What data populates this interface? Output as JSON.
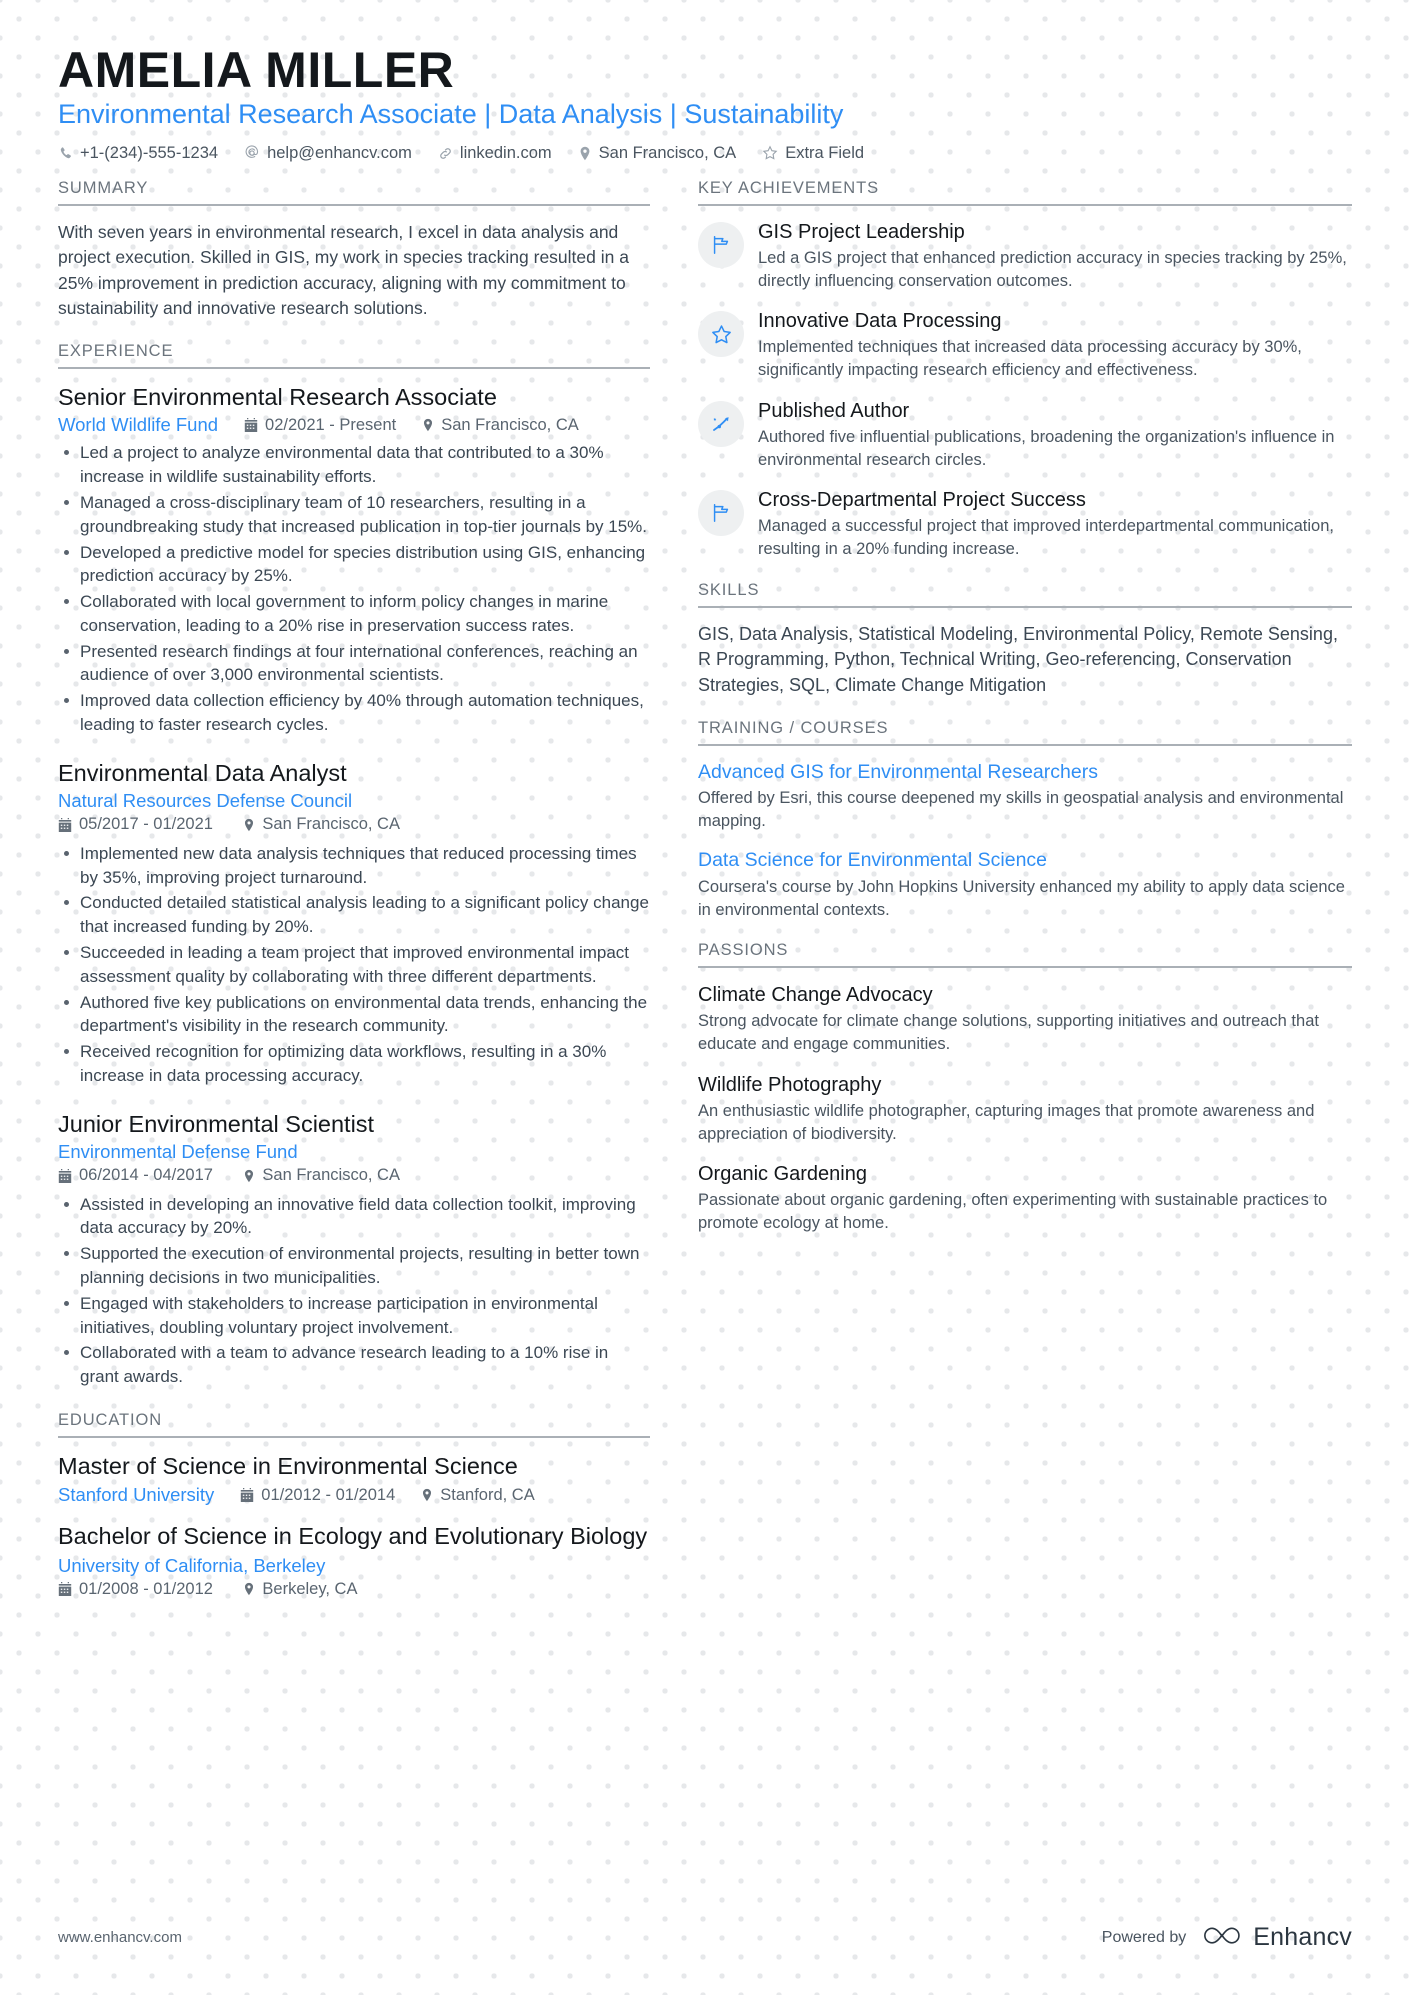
{
  "theme": {
    "accent": "#2f8ef4",
    "text": "#32404e",
    "muted": "#6b747d",
    "rule": "#aab0b6"
  },
  "header": {
    "name": "AMELIA MILLER",
    "headline": "Environmental Research Associate | Data Analysis | Sustainability",
    "contacts": [
      {
        "icon": "phone-icon",
        "text": "+1-(234)-555-1234"
      },
      {
        "icon": "email-icon",
        "text": "help@enhancv.com"
      },
      {
        "icon": "link-icon",
        "text": "linkedin.com"
      },
      {
        "icon": "location-icon",
        "text": "San Francisco, CA"
      },
      {
        "icon": "star-icon",
        "text": "Extra Field"
      }
    ]
  },
  "left": {
    "summary": {
      "title": "SUMMARY",
      "text": "With seven years in environmental research, I excel in data analysis and project execution. Skilled in GIS, my work in species tracking resulted in a 25% improvement in prediction accuracy, aligning with my commitment to sustainability and innovative research solutions."
    },
    "experience": {
      "title": "EXPERIENCE",
      "jobs": [
        {
          "title": "Senior Environmental Research Associate",
          "company": "World Wildlife Fund",
          "dates": "02/2021 - Present",
          "location": "San Francisco, CA",
          "inline_meta": true,
          "bullets": [
            "Led a project to analyze environmental data that contributed to a 30% increase in wildlife sustainability efforts.",
            "Managed a cross-disciplinary team of 10 researchers, resulting in a groundbreaking study that increased publication in top-tier journals by 15%.",
            "Developed a predictive model for species distribution using GIS, enhancing prediction accuracy by 25%.",
            "Collaborated with local government to inform policy changes in marine conservation, leading to a 20% rise in preservation success rates.",
            "Presented research findings at four international conferences, reaching an audience of over 3,000 environmental scientists.",
            "Improved data collection efficiency by 40% through automation techniques, leading to faster research cycles."
          ]
        },
        {
          "title": "Environmental Data Analyst",
          "company": "Natural Resources Defense Council",
          "dates": "05/2017 - 01/2021",
          "location": "San Francisco, CA",
          "inline_meta": false,
          "bullets": [
            "Implemented new data analysis techniques that reduced processing times by 35%, improving project turnaround.",
            "Conducted detailed statistical analysis leading to a significant policy change that increased funding by 20%.",
            "Succeeded in leading a team project that improved environmental impact assessment quality by collaborating with three different departments.",
            "Authored five key publications on environmental data trends, enhancing the department's visibility in the research community.",
            "Received recognition for optimizing data workflows, resulting in a 30% increase in data processing accuracy."
          ]
        },
        {
          "title": "Junior Environmental Scientist",
          "company": "Environmental Defense Fund",
          "dates": "06/2014 - 04/2017",
          "location": "San Francisco, CA",
          "inline_meta": false,
          "bullets": [
            "Assisted in developing an innovative field data collection toolkit, improving data accuracy by 20%.",
            "Supported the execution of environmental projects, resulting in better town planning decisions in two municipalities.",
            "Engaged with stakeholders to increase participation in environmental initiatives, doubling voluntary project involvement.",
            "Collaborated with a team to advance research leading to a 10% rise in grant awards."
          ]
        }
      ]
    },
    "education": {
      "title": "EDUCATION",
      "items": [
        {
          "degree": "Master of Science in Environmental Science",
          "school": "Stanford University",
          "dates": "01/2012 - 01/2014",
          "location": "Stanford, CA",
          "inline_meta": true
        },
        {
          "degree": "Bachelor of Science in Ecology and Evolutionary Biology",
          "school": "University of California, Berkeley",
          "dates": "01/2008 - 01/2012",
          "location": "Berkeley, CA",
          "inline_meta": false
        }
      ]
    }
  },
  "right": {
    "achievements": {
      "title": "KEY ACHIEVEMENTS",
      "items": [
        {
          "icon": "flag-icon",
          "title": "GIS Project Leadership",
          "text": "Led a GIS project that enhanced prediction accuracy in species tracking by 25%, directly influencing conservation outcomes."
        },
        {
          "icon": "star-icon",
          "title": "Innovative Data Processing",
          "text": "Implemented techniques that increased data processing accuracy by 30%, significantly impacting research efficiency and effectiveness."
        },
        {
          "icon": "trend-arrow-icon",
          "title": "Published Author",
          "text": "Authored five influential publications, broadening the organization's influence in environmental research circles."
        },
        {
          "icon": "flag-icon",
          "title": "Cross-Departmental Project Success",
          "text": "Managed a successful project that improved interdepartmental communication, resulting in a 20% funding increase."
        }
      ]
    },
    "skills": {
      "title": "SKILLS",
      "text": "GIS, Data Analysis, Statistical Modeling, Environmental Policy, Remote Sensing, R Programming, Python, Technical Writing, Geo-referencing, Conservation Strategies, SQL, Climate Change Mitigation"
    },
    "training": {
      "title": "TRAINING / COURSES",
      "items": [
        {
          "title": "Advanced GIS for Environmental Researchers",
          "text": "Offered by Esri, this course deepened my skills in geospatial analysis and environmental mapping."
        },
        {
          "title": "Data Science for Environmental Science",
          "text": "Coursera's course by John Hopkins University enhanced my ability to apply data science in environmental contexts."
        }
      ]
    },
    "passions": {
      "title": "PASSIONS",
      "items": [
        {
          "title": "Climate Change Advocacy",
          "text": "Strong advocate for climate change solutions, supporting initiatives and outreach that educate and engage communities."
        },
        {
          "title": "Wildlife Photography",
          "text": "An enthusiastic wildlife photographer, capturing images that promote awareness and appreciation of biodiversity."
        },
        {
          "title": "Organic Gardening",
          "text": "Passionate about organic gardening, often experimenting with sustainable practices to promote ecology at home."
        }
      ]
    }
  },
  "footer": {
    "url": "www.enhancv.com",
    "powered_by": "Powered by",
    "brand": "Enhancv"
  }
}
